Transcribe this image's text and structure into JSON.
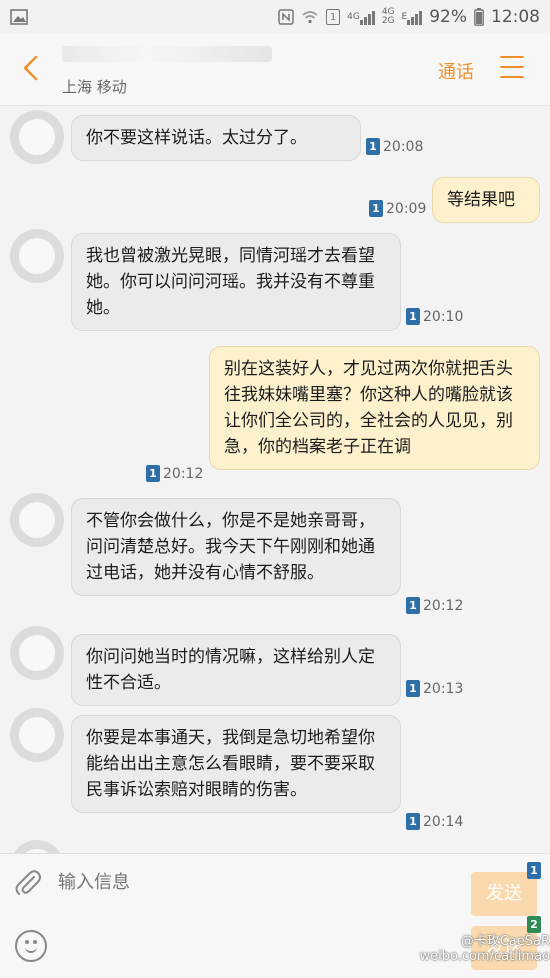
{
  "status_bar": {
    "network_label": "4G",
    "network_label_2": "4G",
    "network_label_3": "2G",
    "data_label": "E",
    "battery_percent": "92%",
    "time": "12:08",
    "sim_badge": "1"
  },
  "header": {
    "carrier": "上海 移动",
    "call_label": "通话"
  },
  "messages": [
    {
      "side": "in",
      "text": "你不要这样说话。太过分了。",
      "time": "20:08",
      "sim": "1"
    },
    {
      "side": "out",
      "text": "等结果吧",
      "time": "20:09",
      "sim": "1"
    },
    {
      "side": "in",
      "text": "我也曾被激光晃眼，同情河瑶才去看望她。你可以问问河瑶。我并没有不尊重她。",
      "time": "20:10",
      "sim": "1"
    },
    {
      "side": "out",
      "text": "别在这装好人，才见过两次你就把舌头往我妹妹嘴里塞？你这种人的嘴脸就该让你们全公司的，全社会的人见见，别急，你的档案老子正在调",
      "time": "20:12",
      "sim": "1"
    },
    {
      "side": "in",
      "text": "不管你会做什么，你是不是她亲哥哥，问问清楚总好。我今天下午刚刚和她通过电话，她并没有心情不舒服。",
      "time": "20:12",
      "sim": "1"
    },
    {
      "side": "in",
      "text": "你问问她当时的情况嘛，这样给别人定性不合适。",
      "time": "20:13",
      "sim": "1"
    },
    {
      "side": "in",
      "text": "你要是本事通天，我倒是急切地希望你能给出出主意怎么看眼睛，要不要采取民事诉讼索赔对眼睛的伤害。",
      "time": "20:14",
      "sim": "1"
    }
  ],
  "input": {
    "placeholder": "输入信息",
    "send_1_label": "发送",
    "send_1_sim": "1",
    "send_2_label": "发送",
    "send_2_sim": "2"
  },
  "watermark": {
    "line1": "@卡玫CaeSaR",
    "line2": "weibo.com/catlimao"
  },
  "colors": {
    "accent": "#f0902a",
    "incoming_bubble": "#ebebeb",
    "outgoing_bubble": "#fdf0cd",
    "sim1": "#2f6fa8",
    "sim2": "#2e8b57"
  }
}
